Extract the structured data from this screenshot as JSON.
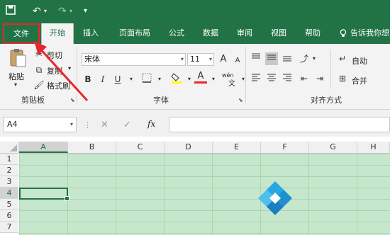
{
  "quick_access": {
    "save_icon": "save-icon",
    "undo_icon": "undo-icon",
    "redo_icon": "redo-icon",
    "customize_icon": "customize-icon"
  },
  "tabs": [
    "文件",
    "开始",
    "插入",
    "页面布局",
    "公式",
    "数据",
    "审阅",
    "视图",
    "帮助"
  ],
  "tell_me": "告诉我你想",
  "clipboard": {
    "paste": "粘贴",
    "cut": "剪切",
    "copy": "复制",
    "format_painter": "格式刷",
    "group": "剪贴板"
  },
  "font": {
    "name": "宋体",
    "size": "11",
    "grow": "A",
    "shrink": "A",
    "bold": "B",
    "italic": "I",
    "underline": "U",
    "font_color_letter": "A",
    "phonetic": "wén",
    "group": "字体"
  },
  "alignment": {
    "wrap": "自动",
    "merge": "合并",
    "group": "对齐方式"
  },
  "formula_bar": {
    "name_box": "A4",
    "cancel": "✕",
    "enter": "✓",
    "fx": "fx"
  },
  "columns": [
    "A",
    "B",
    "C",
    "D",
    "E",
    "F",
    "G",
    "H"
  ],
  "rows": [
    "1",
    "2",
    "3",
    "4",
    "5",
    "6",
    "7"
  ],
  "colors": {
    "brand": "#217346",
    "highlight": "#e8262b"
  }
}
